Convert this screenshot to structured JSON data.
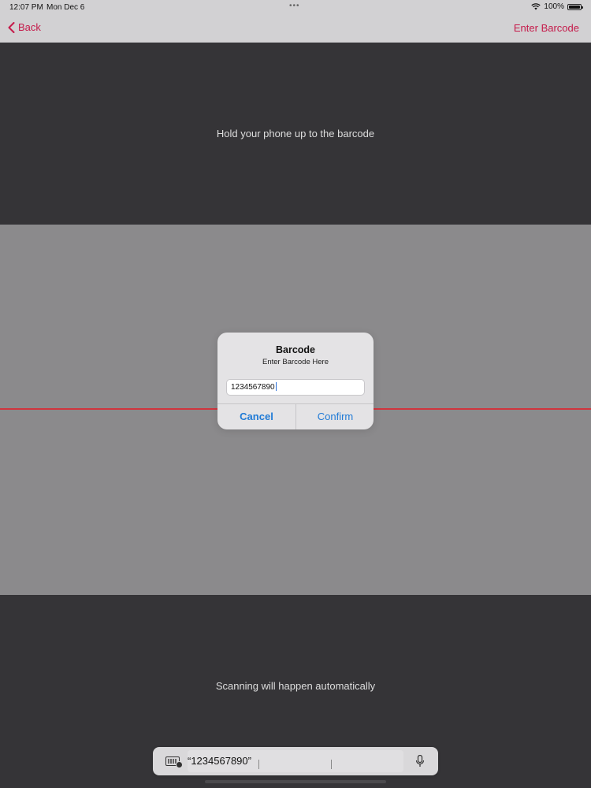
{
  "status_bar": {
    "time": "12:07 PM",
    "date": "Mon Dec 6",
    "battery_percent": "100%",
    "icons": [
      "wifi-icon",
      "battery-icon"
    ]
  },
  "nav": {
    "back_label": "Back",
    "enter_barcode_label": "Enter Barcode",
    "accent_color": "#c51a4a"
  },
  "scanner": {
    "top_hint": "Hold your phone up to the barcode",
    "bottom_hint": "Scanning will happen automatically",
    "scan_line_color": "#d0353d"
  },
  "alert": {
    "title": "Barcode",
    "message": "Enter Barcode Here",
    "input_value": "1234567890",
    "cancel_label": "Cancel",
    "confirm_label": "Confirm",
    "button_color": "#1f7ad6"
  },
  "keyboard_bar": {
    "suggestion": "“1234567890”",
    "icons": [
      "keyboard-icon",
      "mic-icon"
    ]
  }
}
